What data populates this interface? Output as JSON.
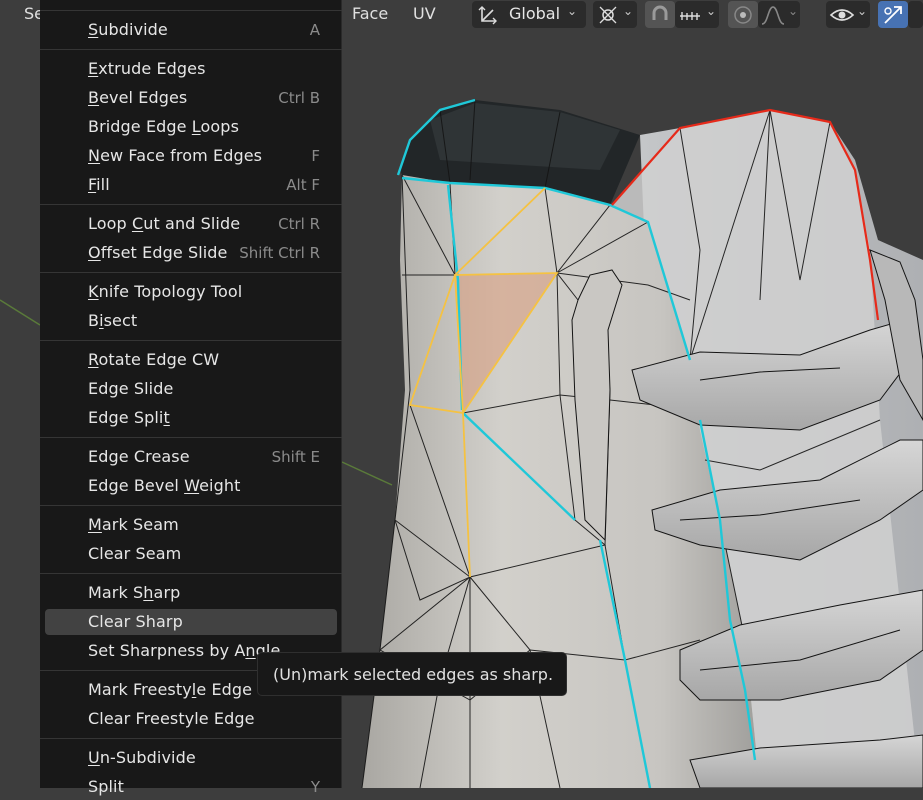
{
  "header": {
    "left_clip": "Se",
    "face": "Face",
    "uv": "UV",
    "orientation": "Global"
  },
  "menu": {
    "items": [
      {
        "label_parts": [
          "",
          "S",
          "ubdivide"
        ],
        "shortcut": "A"
      },
      {
        "label_parts": [
          "",
          "E",
          "xtrude Edges"
        ],
        "shortcut": ""
      },
      {
        "label_parts": [
          "",
          "B",
          "evel Edges"
        ],
        "shortcut": "Ctrl B"
      },
      {
        "label_parts": [
          "Bridge Edge ",
          "L",
          "oops"
        ],
        "shortcut": ""
      },
      {
        "label_parts": [
          "",
          "N",
          "ew Face from Edges"
        ],
        "shortcut": "F"
      },
      {
        "label_parts": [
          "",
          "F",
          "ill"
        ],
        "shortcut": "Alt F"
      },
      {
        "label_parts": [
          "Loop ",
          "C",
          "ut and Slide"
        ],
        "shortcut": "Ctrl R"
      },
      {
        "label_parts": [
          "",
          "O",
          "ffset Edge Slide"
        ],
        "shortcut": "Shift Ctrl R"
      },
      {
        "label_parts": [
          "",
          "K",
          "nife Topology Tool"
        ],
        "shortcut": ""
      },
      {
        "label_parts": [
          "B",
          "i",
          "sect"
        ],
        "shortcut": ""
      },
      {
        "label_parts": [
          "",
          "R",
          "otate Edge CW"
        ],
        "shortcut": ""
      },
      {
        "label_parts": [
          "Edge Slide",
          "",
          ""
        ],
        "shortcut": ""
      },
      {
        "label_parts": [
          "Edge Spli",
          "t",
          ""
        ],
        "shortcut": ""
      },
      {
        "label_parts": [
          "Edge Crease",
          "",
          ""
        ],
        "shortcut": "Shift E"
      },
      {
        "label_parts": [
          "Edge Bevel ",
          "W",
          "eight"
        ],
        "shortcut": ""
      },
      {
        "label_parts": [
          "",
          "M",
          "ark Seam"
        ],
        "shortcut": ""
      },
      {
        "label_parts": [
          "Clear Seam",
          "",
          ""
        ],
        "shortcut": ""
      },
      {
        "label_parts": [
          "Mark S",
          "h",
          "arp"
        ],
        "shortcut": ""
      },
      {
        "label_parts": [
          "Clear Sharp",
          "",
          ""
        ],
        "shortcut": ""
      },
      {
        "label_parts": [
          "Set Sharpness by A",
          "n",
          "gle"
        ],
        "shortcut": ""
      },
      {
        "label_parts": [
          "Mark Freesty",
          "l",
          "e Edge"
        ],
        "shortcut": ""
      },
      {
        "label_parts": [
          "Clear Freestyle Edge",
          "",
          ""
        ],
        "shortcut": ""
      },
      {
        "label_parts": [
          "",
          "U",
          "n-Subdivide"
        ],
        "shortcut": ""
      },
      {
        "label_parts": [
          "Split",
          "",
          ""
        ],
        "shortcut": "Y"
      }
    ]
  },
  "tooltip": {
    "text": "(Un)mark selected edges as sharp."
  },
  "colors": {
    "menu_bg": "#181818",
    "highlight": "#424242",
    "selected_edge": "#f5c242",
    "seam_edge": "#1fc8d8",
    "sharp_edge": "#e62a1a"
  }
}
